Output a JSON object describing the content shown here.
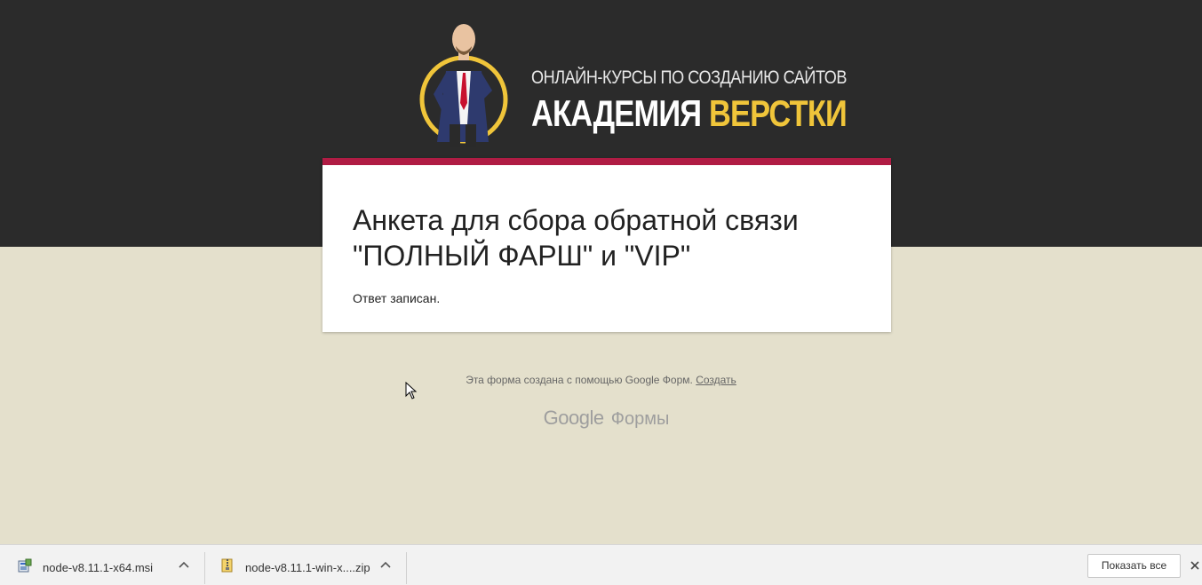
{
  "logo": {
    "subtitle": "ОНЛАЙН-КУРСЫ ПО СОЗДАНИЮ САЙТОВ",
    "title_main": "АКАДЕМИЯ ",
    "title_accent": "ВЕРСТКИ"
  },
  "card": {
    "title": "Анкета для сбора обратной связи \"ПОЛНЫЙ ФАРШ\" и \"VIP\"",
    "message": "Ответ записан."
  },
  "footer": {
    "text": "Эта форма создана с помощью Google Форм.",
    "create_link": "Создать",
    "brand_google": "Google",
    "brand_forms": "Формы"
  },
  "downloads": {
    "items": [
      {
        "name": "node-v8.11.1-x64.msi",
        "icon": "msi-installer-icon"
      },
      {
        "name": "node-v8.11.1-win-x....zip",
        "icon": "zip-archive-icon"
      }
    ],
    "show_all": "Показать все"
  },
  "colors": {
    "header_bg": "#2b2b2b",
    "page_bg": "#e4e0cc",
    "card_accent": "#b01c44",
    "logo_accent": "#f0c53a"
  }
}
